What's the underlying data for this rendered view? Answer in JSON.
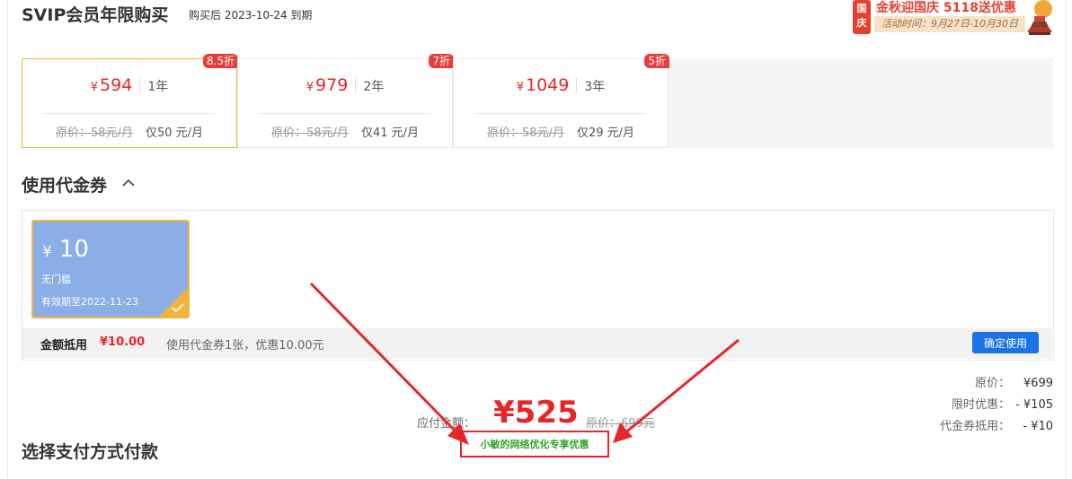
{
  "header": {
    "title": "SVIP会员年限购买",
    "expire_prefix": "购买后",
    "expire_date": "2023-10-24",
    "expire_suffix": "到期"
  },
  "promo": {
    "badge": "国庆",
    "text": "金秋迎国庆 5118送优惠",
    "sub": "活动时间：9月27日-10月30日",
    "icon": "temple-lantern-icon"
  },
  "plans": [
    {
      "yen": "¥",
      "price": "594",
      "years": "1年",
      "orig": "原价：58元/月",
      "per_month": "仅50 元/月",
      "badge": "8.5折",
      "selected": true
    },
    {
      "yen": "¥",
      "price": "979",
      "years": "2年",
      "orig": "原价：58元/月",
      "per_month": "仅41 元/月",
      "badge": "7折",
      "selected": false
    },
    {
      "yen": "¥",
      "price": "1049",
      "years": "3年",
      "orig": "原价：58元/月",
      "per_month": "仅29 元/月",
      "badge": "5折",
      "selected": false
    }
  ],
  "coupon": {
    "section_title": "使用代金券",
    "card": {
      "yen": "¥",
      "amount": "10",
      "condition": "无门槛",
      "valid": "有效期至2022-11-23"
    },
    "deduct_label": "金额抵用",
    "deduct_value": "¥10.00",
    "info": "使用代金券1张，优惠10.00元",
    "confirm_label": "确定使用"
  },
  "summary": {
    "original_label": "原价：",
    "original_value": "¥699",
    "discount_label": "限时优惠：",
    "discount_value": "- ¥105",
    "coupon_label": "代金券抵用：",
    "coupon_value": "- ¥10"
  },
  "payable": {
    "label": "应付金额：",
    "amount": "¥525",
    "original": "原价：699元"
  },
  "annotation": {
    "note": "小敏的网络优化专享优惠",
    "color": "#e8262a"
  },
  "payment": {
    "section_title": "选择支付方式付款"
  }
}
